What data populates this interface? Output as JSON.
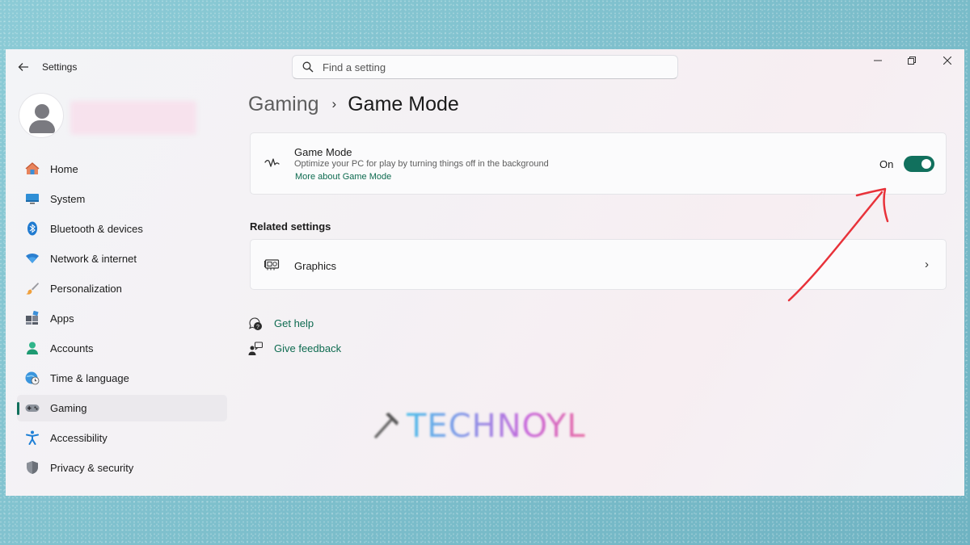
{
  "window": {
    "app_title": "Settings",
    "controls": {
      "minimize": "—",
      "maximize": "❐",
      "close": "✕"
    }
  },
  "search": {
    "placeholder": "Find a setting",
    "value": ""
  },
  "sidebar": {
    "items": [
      {
        "label": "Home",
        "icon": "home-icon",
        "active": false
      },
      {
        "label": "System",
        "icon": "system-icon",
        "active": false
      },
      {
        "label": "Bluetooth & devices",
        "icon": "bluetooth-icon",
        "active": false
      },
      {
        "label": "Network & internet",
        "icon": "wifi-icon",
        "active": false
      },
      {
        "label": "Personalization",
        "icon": "brush-icon",
        "active": false
      },
      {
        "label": "Apps",
        "icon": "apps-icon",
        "active": false
      },
      {
        "label": "Accounts",
        "icon": "accounts-icon",
        "active": false
      },
      {
        "label": "Time & language",
        "icon": "globe-clock-icon",
        "active": false
      },
      {
        "label": "Gaming",
        "icon": "gamepad-icon",
        "active": true
      },
      {
        "label": "Accessibility",
        "icon": "accessibility-icon",
        "active": false
      },
      {
        "label": "Privacy & security",
        "icon": "shield-icon",
        "active": false
      }
    ]
  },
  "breadcrumb": {
    "parent": "Gaming",
    "separator": "›",
    "current": "Game Mode"
  },
  "game_mode": {
    "title": "Game Mode",
    "description": "Optimize your PC for play by turning things off in the background",
    "link": "More about Game Mode",
    "toggle_label": "On",
    "toggle_on": true
  },
  "related": {
    "title": "Related settings",
    "items": [
      {
        "label": "Graphics",
        "icon": "graphics-card-icon",
        "chevron": "›"
      }
    ]
  },
  "help": {
    "get_help": "Get help",
    "give_feedback": "Give feedback"
  },
  "watermark": {
    "text": "TECHNOYL"
  },
  "colors": {
    "accent": "#11705d",
    "link": "#0e6b50",
    "annotation_arrow": "#e8323a"
  }
}
